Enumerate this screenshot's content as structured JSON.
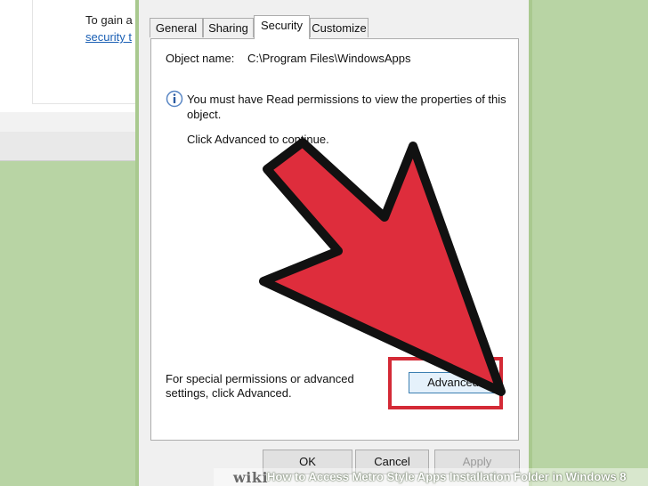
{
  "background_window": {
    "text_line": "To gain a",
    "link_text": "security t"
  },
  "dialog": {
    "tabs": [
      "General",
      "Sharing",
      "Security",
      "Customize"
    ],
    "active_tab_index": 2,
    "object_name_label": "Object name:",
    "object_name_value": "C:\\Program Files\\WindowsApps",
    "info_message": "You must have Read permissions to view the properties of this object.",
    "continue_text": "Click Advanced to continue.",
    "special_permissions_text": "For special permissions or advanced settings, click Advanced.",
    "advanced_button": "Advanced",
    "ok_button": "OK",
    "cancel_button": "Cancel",
    "apply_button": "Apply"
  },
  "annotation": {
    "arrow_color": "#de2d3c",
    "highlight_color": "#d42a36"
  },
  "watermark": {
    "logo": "wiki",
    "caption": "How to Access Metro Style Apps Installation Folder in Windows 8"
  },
  "icons": {
    "info": "info-shield-icon"
  }
}
